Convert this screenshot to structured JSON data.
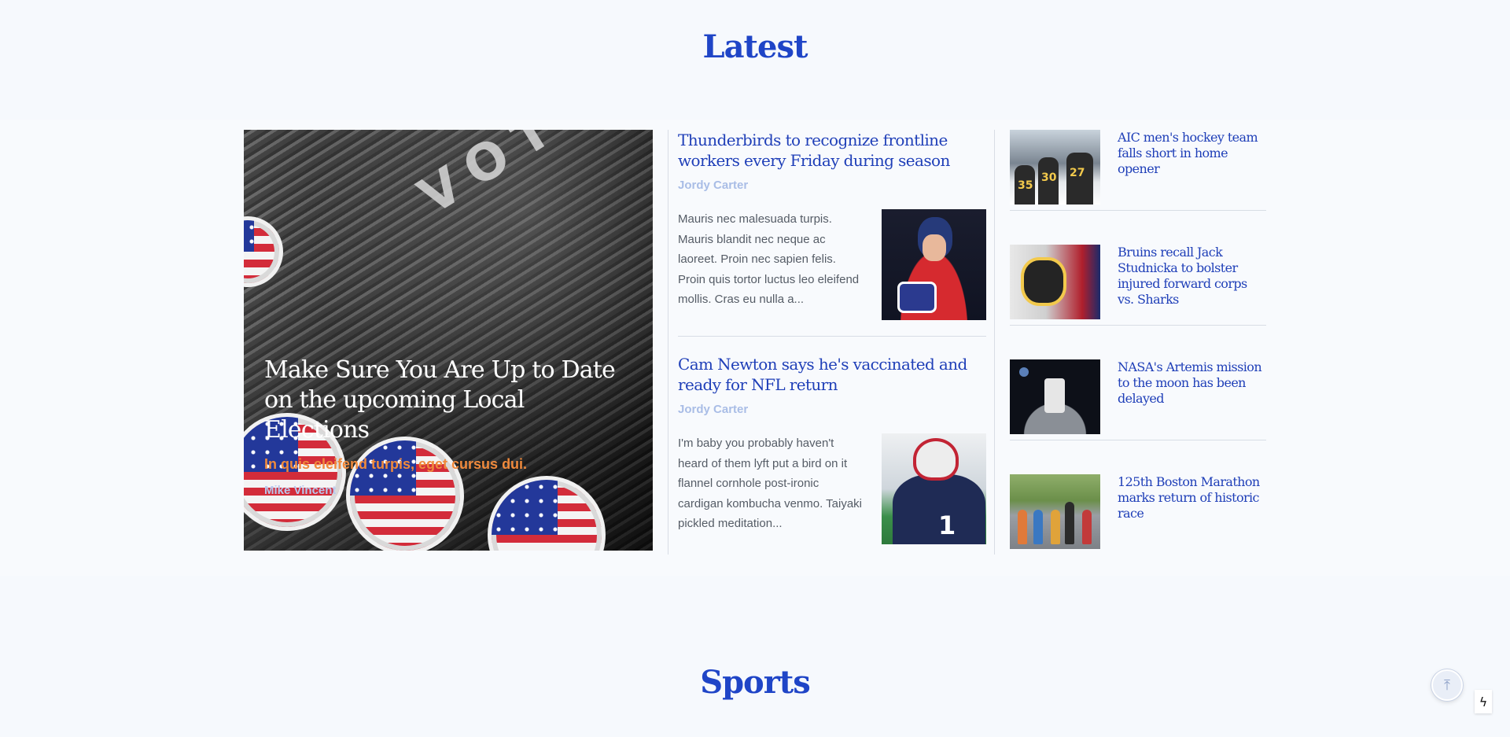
{
  "sections": {
    "latest_title": "Latest",
    "sports_title": "Sports"
  },
  "featured": {
    "title": "Make Sure You Are Up to Date on the upcoming Local Elections",
    "subtitle": "In quis eleifend turpis, eget cursus dui.",
    "author": "Mike Vincent",
    "image_text": "VOTING"
  },
  "middle_articles": [
    {
      "title": "Thunderbirds to recognize frontline workers every Friday during season",
      "author": "Jordy Carter",
      "excerpt": "Mauris nec malesuada turpis. Mauris blandit nec neque ac laoreet. Proin nec sapien felis. Proin quis tortor luctus leo eleifend mollis. Cras eu nulla a..."
    },
    {
      "title": "Cam Newton says he's vaccinated and ready for NFL return",
      "author": "Jordy Carter",
      "excerpt": "I'm baby you probably haven't heard of them lyft put a bird on it flannel cornhole post-ironic cardigan kombucha venmo. Taiyaki pickled meditation...",
      "image_number": "1"
    }
  ],
  "side_articles": [
    {
      "title": "AIC men's hockey team falls short in home opener",
      "jersey_numbers": [
        "35",
        "30",
        "27"
      ]
    },
    {
      "title": "Bruins recall Jack Studnicka to bolster injured forward corps vs. Sharks"
    },
    {
      "title": "NASA's Artemis mission to the moon has been delayed"
    },
    {
      "title": "125th Boston Marathon marks return of historic race"
    }
  ],
  "controls": {
    "scroll_top_icon": "arrow-up-icon",
    "scroll_top_glyph": "⤒",
    "bolt_icon": "lightning-icon",
    "bolt_glyph": "ϟ"
  },
  "colors": {
    "accent": "#1f45c7",
    "headline": "#1f3fb8",
    "subtitle_orange": "#f08a3c",
    "author": "#a9bde6",
    "background": "#f6f9fd"
  }
}
